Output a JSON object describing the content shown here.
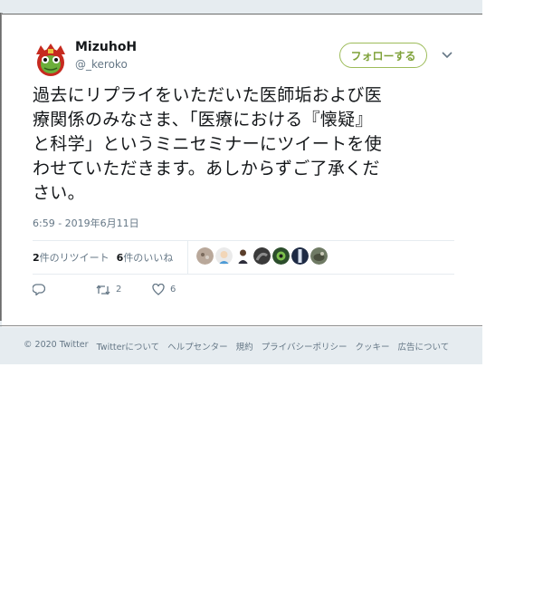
{
  "tweet": {
    "user": {
      "name": "MizuhoH",
      "handle": "@_keroko"
    },
    "follow_label": "フォローする",
    "text_lines": [
      "過去にリプライをいただいた医師垢および医",
      "療関係のみなさま、「医療における『懐疑』",
      "と科学」というミニセミナーにツイートを使",
      "わせていただきます。あしからずご了承くだ",
      "さい。"
    ],
    "timestamp": "6:59 - 2019年6月11日",
    "stats": {
      "retweets_count": "2",
      "retweets_label": "件のリツイート",
      "likes_count": "6",
      "likes_label": "件のいいね"
    },
    "actions": {
      "retweet_count": "2",
      "like_count": "6"
    },
    "colors": {
      "follow_accent": "#7fa23a",
      "muted": "#657786"
    }
  },
  "footer": {
    "links": [
      "© 2020 Twitter",
      "Twitterについて",
      "ヘルプセンター",
      "規約",
      "プライバシーポリシー",
      "クッキー",
      "広告について"
    ]
  },
  "icons": [
    "avatar-frog-icon",
    "chevron-down-icon",
    "reply-icon",
    "retweet-icon",
    "heart-icon"
  ]
}
